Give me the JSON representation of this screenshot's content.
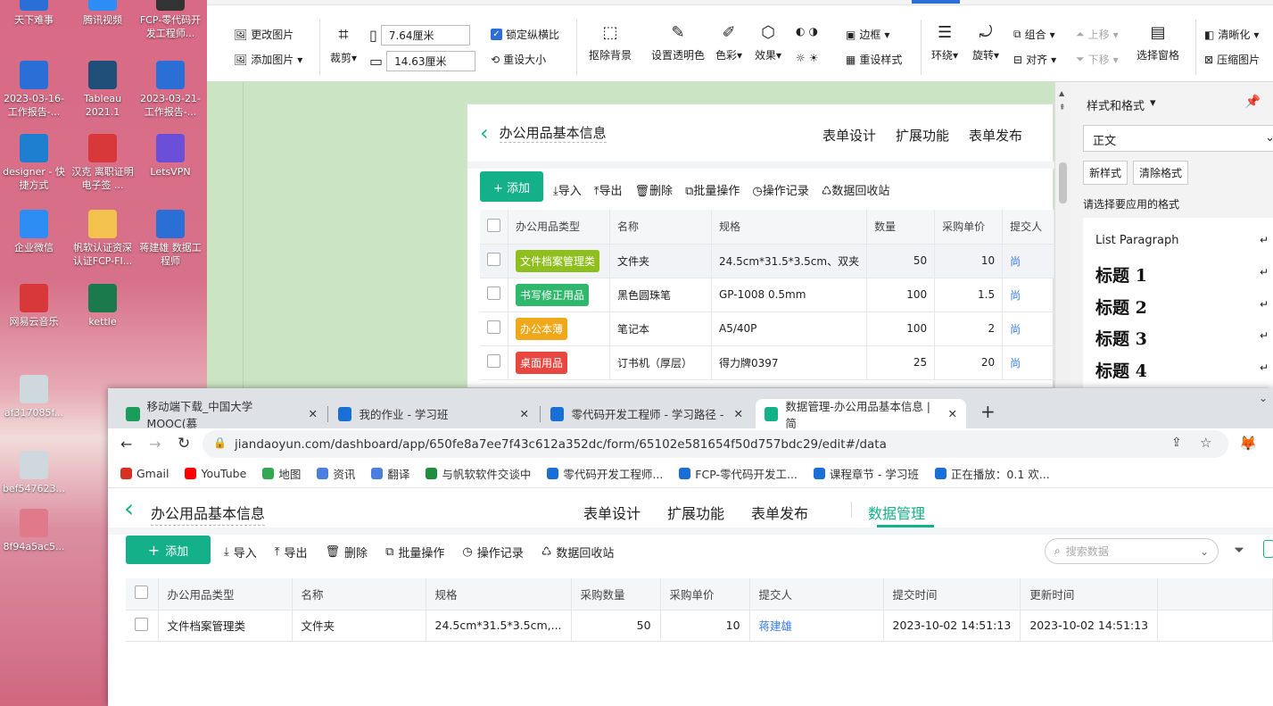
{
  "desktop": {
    "icons": [
      {
        "label": "天下难事",
        "icon": "word-doc-icon",
        "color": "#2b6fd6"
      },
      {
        "label": "腾讯视频",
        "icon": "tencent-video-icon",
        "color": "#2e8df5"
      },
      {
        "label": "FCP-零代码开发工程师...",
        "icon": "zip-icon",
        "color": "#333333"
      },
      {
        "label": "2023-03-16-工作报告-...",
        "icon": "word-doc-icon",
        "color": "#2b6fd6"
      },
      {
        "label": "Tableau 2021.1",
        "icon": "tableau-icon",
        "color": "#1f4e79"
      },
      {
        "label": "2023-03-21-工作报告-...",
        "icon": "word-doc-icon",
        "color": "#2b6fd6"
      },
      {
        "label": "designer - 快捷方式",
        "icon": "designer-icon",
        "color": "#1e7fd1"
      },
      {
        "label": "汉克 离职证明电子签 ...",
        "icon": "pdf-icon",
        "color": "#d9383a"
      },
      {
        "label": "LetsVPN",
        "icon": "letsvpn-icon",
        "color": "#6b4fd8"
      },
      {
        "label": "企业微信",
        "icon": "wecom-icon",
        "color": "#2e8df5"
      },
      {
        "label": "帆软认证资深认证FCP-FI...",
        "icon": "folder-icon",
        "color": "#f2c14e"
      },
      {
        "label": "蒋建雄 数据工程师",
        "icon": "word-doc-icon",
        "color": "#2b6fd6"
      },
      {
        "label": "网易云音乐",
        "icon": "netease-music-icon",
        "color": "#d9383a"
      },
      {
        "label": "kettle",
        "icon": "kettle-icon",
        "color": "#1a7a4c"
      },
      {
        "label": "af317085f...",
        "icon": "image-file-icon",
        "color": "#cfd8dc"
      },
      {
        "label": "bef547623...",
        "icon": "image-file-icon",
        "color": "#cfd8dc"
      },
      {
        "label": "8f94a5ac5...",
        "icon": "image-file-icon",
        "color": "#e07a8a"
      }
    ]
  },
  "ribbon": {
    "change_picture": "更改图片",
    "add_picture": "添加图片",
    "crop": "裁剪",
    "width": "7.64厘米",
    "height": "14.63厘米",
    "lock_ratio": "锁定纵横比",
    "reset_size": "重设大小",
    "remove_bg": "抠除背景",
    "set_transparent": "设置透明色",
    "color": "色彩",
    "effects": "效果",
    "border": "边框",
    "reset_style": "重设样式",
    "wrap": "环绕",
    "rotate": "旋转",
    "group": "组合",
    "align": "对齐",
    "bring_forward": "上移",
    "send_backward": "下移",
    "selection_pane": "选择窗格",
    "sharpen": "清晰化",
    "compress": "压缩图片"
  },
  "styles_pane": {
    "title": "样式和格式",
    "current": "正文",
    "new_style": "新样式",
    "clear_format": "清除格式",
    "hint": "请选择要应用的格式",
    "items": [
      "List Paragraph",
      "标题  1",
      "标题  2",
      "标题  3",
      "标题  4"
    ]
  },
  "embedded": {
    "title": "办公用品基本信息",
    "nav": [
      "表单设计",
      "扩展功能",
      "表单发布"
    ],
    "add": "+ 添加",
    "toolbar": [
      "导入",
      "导出",
      "删除",
      "批量操作",
      "操作记录",
      "数据回收站"
    ],
    "columns": [
      "办公用品类型",
      "名称",
      "规格",
      "数量",
      "采购单价",
      "提交人"
    ],
    "rows": [
      {
        "type": "文件档案管理类",
        "tag_color": "#8fbf1e",
        "name": "文件夹",
        "spec": "24.5cm*31.5*3.5cm、双夹",
        "qty": "50",
        "price": "10",
        "submitter": "尚"
      },
      {
        "type": "书写修正用品",
        "tag_color": "#2fb86b",
        "name": "黑色圆珠笔",
        "spec": "GP-1008 0.5mm",
        "qty": "100",
        "price": "1.5",
        "submitter": "尚"
      },
      {
        "type": "办公本薄",
        "tag_color": "#f0a81b",
        "name": "笔记本",
        "spec": "A5/40P",
        "qty": "100",
        "price": "2",
        "submitter": "尚"
      },
      {
        "type": "桌面用品",
        "tag_color": "#e8473f",
        "name": "订书机（厚层）",
        "spec": "得力牌0397",
        "qty": "25",
        "price": "20",
        "submitter": "尚"
      }
    ]
  },
  "browser": {
    "tabs": [
      {
        "title": "移动端下载_中国大学MOOC(慕",
        "color": "#1a9d5b"
      },
      {
        "title": "我的作业 - 学习班",
        "color": "#1a6fd6"
      },
      {
        "title": "零代码开发工程师 - 学习路径 -",
        "color": "#1a6fd6"
      },
      {
        "title": "数据管理-办公用品基本信息 | 简",
        "color": "#14b089"
      }
    ],
    "url": "jiandaoyun.com/dashboard/app/650fe8a7ee7f43c612a352dc/form/65102e581654f50d757bdc29/edit#/data",
    "bookmarks": [
      "Gmail",
      "YouTube",
      "地图",
      "资讯",
      "翻译",
      "与帆软软件交谈中",
      "零代码开发工程师...",
      "FCP-零代码开发工...",
      "课程章节 - 学习班",
      "正在播放：0.1 欢..."
    ]
  },
  "app": {
    "title": "办公用品基本信息",
    "nav": [
      "表单设计",
      "扩展功能",
      "表单发布",
      "数据管理"
    ],
    "active_nav": "数据管理",
    "add": "添加",
    "toolbar": [
      "导入",
      "导出",
      "删除",
      "批量操作",
      "操作记录",
      "数据回收站"
    ],
    "search_placeholder": "搜索数据",
    "columns": [
      "办公用品类型",
      "名称",
      "规格",
      "采购数量",
      "采购单价",
      "提交人",
      "提交时间",
      "更新时间"
    ],
    "rows": [
      {
        "type": "文件档案管理类",
        "name": "文件夹",
        "spec": "24.5cm*31.5*3.5cm,...",
        "qty": "50",
        "price": "10",
        "submitter": "蒋建雄",
        "created": "2023-10-02 14:51:13",
        "updated": "2023-10-02 14:51:13"
      }
    ]
  }
}
